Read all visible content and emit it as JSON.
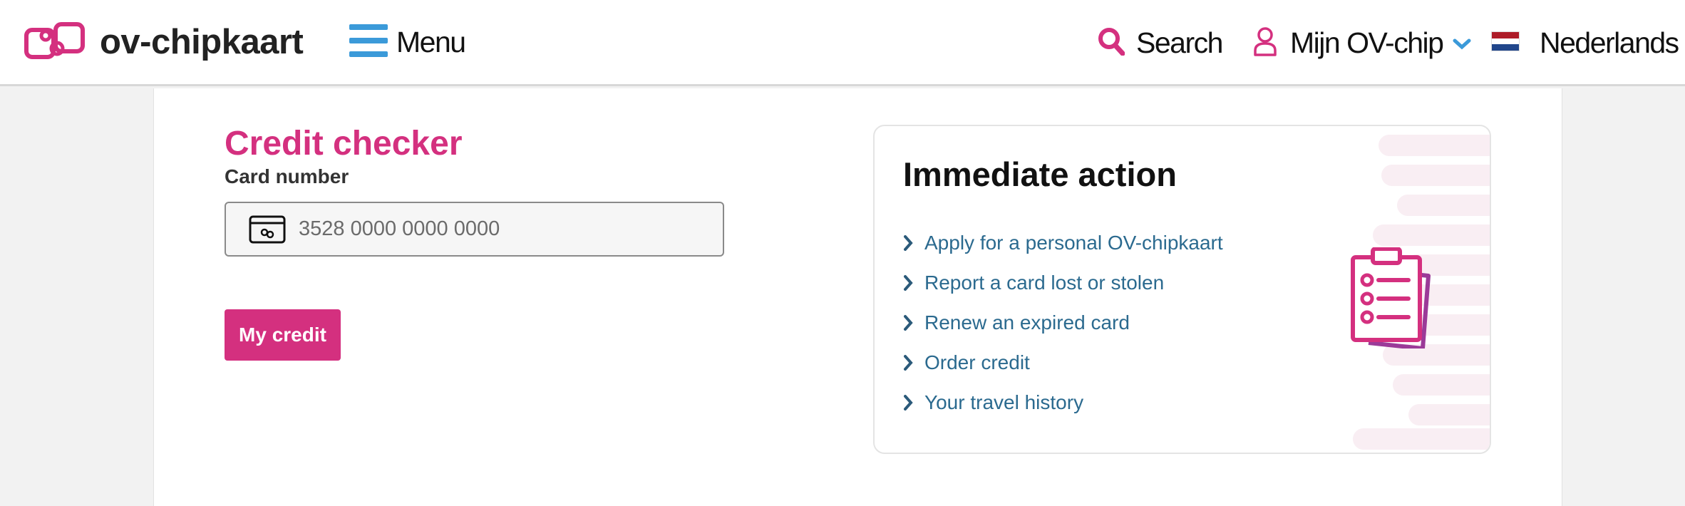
{
  "header": {
    "logo_text": "ov-chipkaart",
    "menu_label": "Menu",
    "search_label": "Search",
    "account_label": "Mijn OV-chip",
    "language_label": "Nederlands"
  },
  "credit_checker": {
    "title": "Credit checker",
    "card_number_label": "Card number",
    "card_number_placeholder": "3528 0000 0000 0000",
    "card_number_value": "",
    "submit_label": "My credit"
  },
  "immediate_action": {
    "title": "Immediate action",
    "links": [
      {
        "label": "Apply for a personal OV-chipkaart"
      },
      {
        "label": "Report a card lost or stolen"
      },
      {
        "label": "Renew an expired card"
      },
      {
        "label": "Order credit"
      },
      {
        "label": "Your travel history"
      }
    ]
  },
  "colors": {
    "brand": "#d4307f",
    "link": "#2b6a8f",
    "menu_icon": "#3b9ad9",
    "chevron_accent": "#3b9ad9"
  },
  "icons": {
    "logo": "ov-chipkaart-logo-icon",
    "menu": "hamburger-icon",
    "search": "search-icon",
    "account": "user-icon",
    "account_dropdown": "chevron-down-icon",
    "language": "dutch-flag-icon",
    "card": "card-icon",
    "link": "chevron-right-icon",
    "illustration": "clipboard-icon"
  }
}
